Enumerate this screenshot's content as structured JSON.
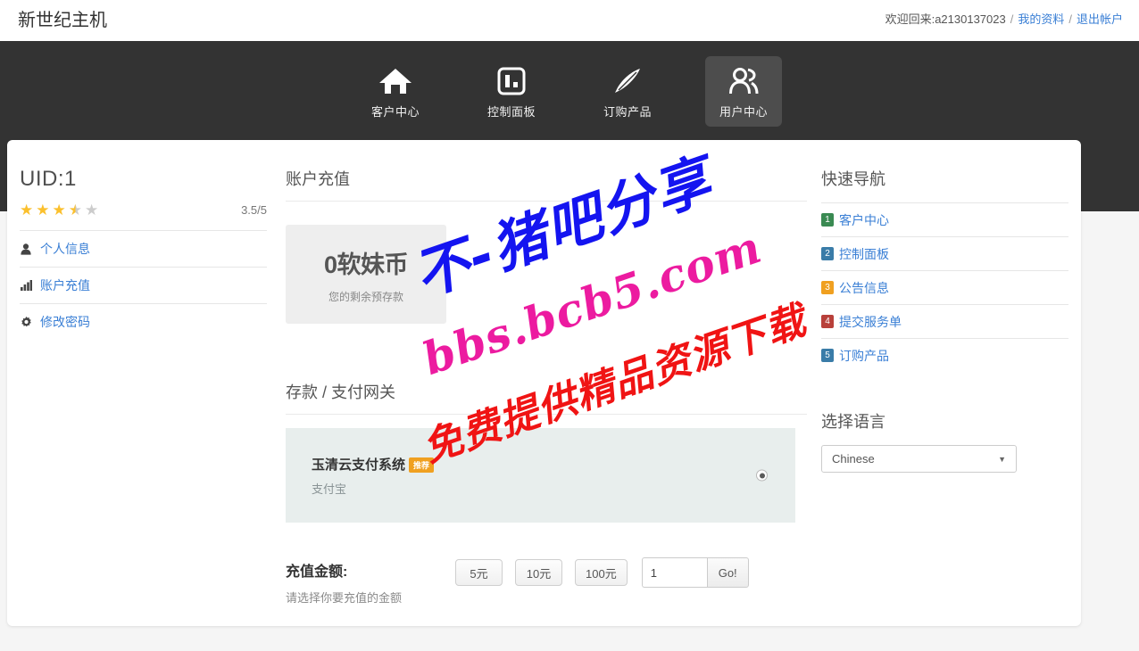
{
  "header": {
    "brand": "新世纪主机",
    "welcome_prefix": "欢迎回来:",
    "username": "a2130137023",
    "separator": "/",
    "profile_link": "我的资料",
    "logout_link": "退出帐户"
  },
  "nav": {
    "items": [
      {
        "label": "客户中心",
        "icon": "home-icon",
        "active": false
      },
      {
        "label": "控制面板",
        "icon": "dashboard-icon",
        "active": false
      },
      {
        "label": "订购产品",
        "icon": "feather-pen-icon",
        "active": false
      },
      {
        "label": "用户中心",
        "icon": "users-icon",
        "active": true
      }
    ]
  },
  "sidebar": {
    "uid": "UID:1",
    "rating_text": "3.5/5",
    "rating_value": 3.5,
    "rating_max": 5,
    "items": [
      {
        "label": "个人信息",
        "icon": "person-icon"
      },
      {
        "label": "账户充值",
        "icon": "bar-chart-icon"
      },
      {
        "label": "修改密码",
        "icon": "gear-icon"
      }
    ]
  },
  "main": {
    "section_title": "账户充值",
    "balance": {
      "amount": "0软妹币",
      "caption": "您的剩余预存款"
    },
    "gateway_section_title": "存款 / 支付网关",
    "gateway": {
      "name": "玉清云支付系统",
      "badge": "推荐",
      "subtitle": "支付宝",
      "selected": true
    },
    "amount": {
      "label": "充值金额:",
      "hint": "请选择你要充值的金额",
      "presets": [
        "5元",
        "10元",
        "100元"
      ],
      "input_value": "1",
      "go_label": "Go!"
    }
  },
  "quicknav": {
    "title": "快速导航",
    "items": [
      {
        "num": "1",
        "label": "客户中心",
        "color": "#3a8a52"
      },
      {
        "num": "2",
        "label": "控制面板",
        "color": "#3a7ca8"
      },
      {
        "num": "3",
        "label": "公告信息",
        "color": "#f0a020"
      },
      {
        "num": "4",
        "label": "提交服务单",
        "color": "#b8403a"
      },
      {
        "num": "5",
        "label": "订购产品",
        "color": "#3a7ca8"
      }
    ]
  },
  "language": {
    "title": "选择语言",
    "selected": "Chinese",
    "caret": "▼"
  },
  "watermarks": {
    "blue": "不-猪吧分享",
    "pink": "bbs.bcb5.com",
    "red": "免费提供精品资源下载"
  },
  "colors": {
    "nav_bg": "#333333",
    "link_blue": "#3a7fd5",
    "star_gold": "#fbc02d",
    "gateway_bg": "#e8eeed",
    "badge_orange": "#f0a020"
  }
}
